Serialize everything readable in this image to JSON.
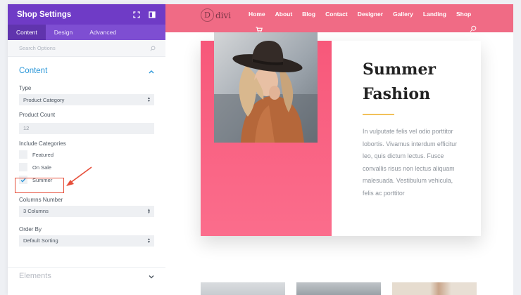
{
  "panel": {
    "title": "Shop Settings",
    "tabs": [
      "Content",
      "Design",
      "Advanced"
    ],
    "search_placeholder": "Search Options",
    "section_title": "Content",
    "type_label": "Type",
    "type_value": "Product Category",
    "count_label": "Product Count",
    "count_value": "12",
    "include_label": "Include Categories",
    "categories": [
      {
        "label": "Featured",
        "checked": false
      },
      {
        "label": "On Sale",
        "checked": false
      },
      {
        "label": "Summer",
        "checked": true
      }
    ],
    "columns_label": "Columns Number",
    "columns_value": "3 Columns",
    "order_label": "Order By",
    "order_value": "Default Sorting",
    "elements_title": "Elements"
  },
  "site": {
    "logo_text": "divi",
    "menu": [
      "Home",
      "About",
      "Blog",
      "Contact",
      "Designer",
      "Gallery",
      "Landing",
      "Shop"
    ],
    "card_title_line1": "Summer",
    "card_title_line2": "Fashion",
    "card_body": "In vulputate felis vel odio porttitor lobortis. Vivamus interdum efficitur leo, quis dictum lectus. Fusce convallis risus non lectus aliquam malesuada. Vestibulum vehicula, felis ac porttitor"
  },
  "colors": {
    "panel_header": "#6f3bc6",
    "tabs_bar": "#7e4ed2",
    "accent_blue": "#2d98d9",
    "nav_pink": "#f06b85",
    "card_pink": "#f7587a",
    "divider_gold": "#f2c15a",
    "annotation_red": "#e64f3b"
  }
}
